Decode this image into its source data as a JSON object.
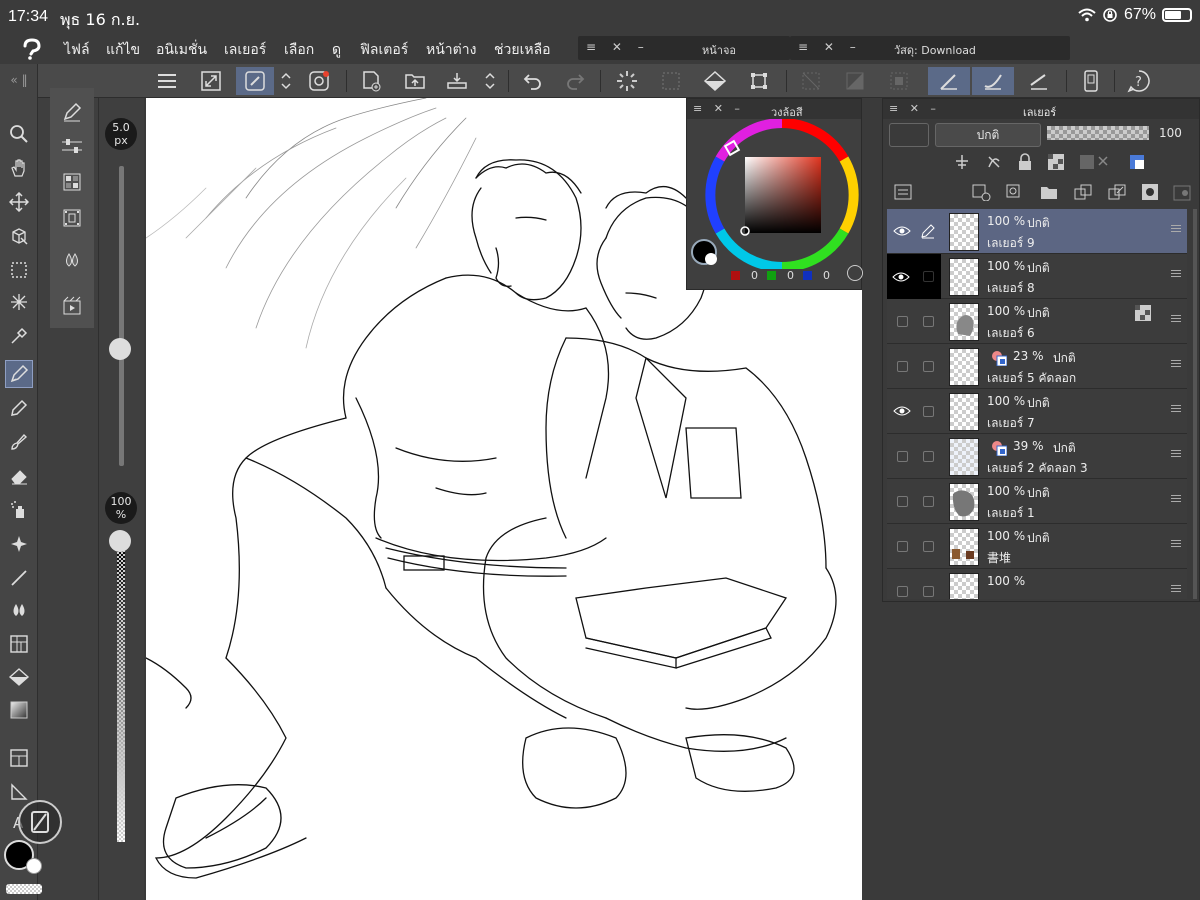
{
  "status_bar": {
    "time": "17:34",
    "date": "พุธ 16 ก.ย.",
    "battery": "67%"
  },
  "menu": {
    "items": [
      "ไฟล์",
      "แก้ไข",
      "อนิเมชั่น",
      "เลเยอร์",
      "เลือก",
      "ดู",
      "ฟิลเตอร์",
      "หน้าต่าง",
      "ช่วยเหลือ"
    ],
    "floating_panels": [
      "หน้าจอ",
      "วัสดุ: Download"
    ]
  },
  "brush": {
    "size": "5.0",
    "size_unit": "px",
    "opacity": "100",
    "opacity_unit": "%"
  },
  "color_panel": {
    "title": "วงล้อสี",
    "r": "0",
    "g": "0",
    "b": "0",
    "hue_color": "#e0341f"
  },
  "layer_panel": {
    "title": "เลเยอร์",
    "blend_mode": "ปกติ",
    "opacity": "100",
    "layers": [
      {
        "opacity": "100 %",
        "mode": "ปกติ",
        "name": "เลเยอร์ 9",
        "visible": true,
        "selected": true
      },
      {
        "opacity": "100 %",
        "mode": "ปกติ",
        "name": "เลเยอร์ 8",
        "visible": true,
        "selected": false
      },
      {
        "opacity": "100 %",
        "mode": "ปกติ",
        "name": "เลเยอร์ 6",
        "visible": false,
        "selected": false
      },
      {
        "opacity": "23 %",
        "mode": "ปกติ",
        "name": "เลเยอร์ 5 คัดลอก",
        "visible": false,
        "selected": false
      },
      {
        "opacity": "100 %",
        "mode": "ปกติ",
        "name": "เลเยอร์ 7",
        "visible": true,
        "selected": false
      },
      {
        "opacity": "39 %",
        "mode": "ปกติ",
        "name": "เลเยอร์ 2 คัดลอก 3",
        "visible": false,
        "selected": false
      },
      {
        "opacity": "100 %",
        "mode": "ปกติ",
        "name": "เลเยอร์ 1",
        "visible": false,
        "selected": false
      },
      {
        "opacity": "100 %",
        "mode": "ปกติ",
        "name": "書堆",
        "visible": false,
        "selected": false
      },
      {
        "opacity": "100 %",
        "mode": "",
        "name": "",
        "visible": false,
        "selected": false
      }
    ]
  },
  "colors": {
    "accent": "#5b6a88",
    "panel_bg": "#3a3a3a",
    "canvas": "#ffffff"
  }
}
